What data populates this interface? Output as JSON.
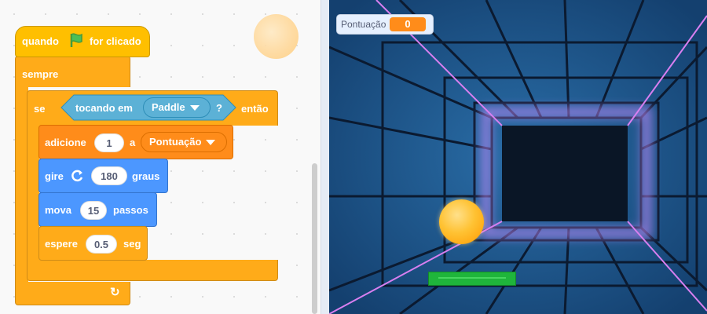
{
  "script": {
    "hat_label": "quando",
    "hat_suffix": "for clicado",
    "forever_label": "sempre",
    "if_label": "se",
    "if_then": "então",
    "touching_label": "tocando em",
    "touching_target": "Paddle",
    "touching_qmark": "?",
    "change_label": "adicione",
    "change_value": "1",
    "change_to": "a",
    "change_variable": "Pontuação",
    "turn_label": "gire",
    "turn_value": "180",
    "turn_unit": "graus",
    "move_label": "mova",
    "move_value": "15",
    "move_unit": "passos",
    "wait_label": "espere",
    "wait_value": "0.5",
    "wait_unit": "seg"
  },
  "stage": {
    "monitor_label": "Pontuação",
    "monitor_value": "0"
  },
  "colors": {
    "events": "#ffbf00",
    "control": "#ffab19",
    "variables": "#ff8c1a",
    "motion": "#4c97ff",
    "sensing": "#5cb1d6",
    "neon_pink": "#d87ff0",
    "paddle": "#1fb53b",
    "ball": "#ffb300"
  }
}
